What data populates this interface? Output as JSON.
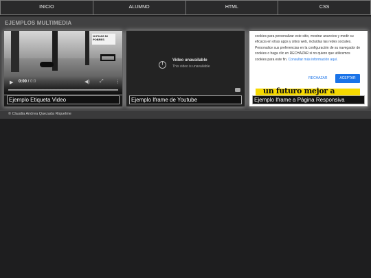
{
  "nav": {
    "items": [
      "INICIO",
      "ALUMNO",
      "HTML",
      "CSS"
    ]
  },
  "section": {
    "title": "EJEMPLOS MULTIMEDIA"
  },
  "cards": {
    "video": {
      "caption": "Ejemplo Etiqueta Video",
      "current_time": "0:00",
      "duration": "0:0",
      "sign_text": "NI PIJAS NI POBRES"
    },
    "youtube": {
      "caption": "Ejemplo Iframe de Youtube",
      "unavailable_title": "Video unavailable",
      "unavailable_sub": "This video is unavailable",
      "icon": "alert-circle-icon"
    },
    "iframe": {
      "caption": "Ejemplo Iframe a Página Responsiva",
      "cookie_text": "cookies para personalizar este sitio, mostrar anuncios y medir su eficacia en otras apps y sitios web, incluidas las redes sociales. Personalice sus preferencias en la configuración de su navegador de cookies o haga clic en RECHAZAR si no quiere que utilicemos cookies para este fin. ",
      "cookie_link": "Consultar más información aquí.",
      "reject_label": "RECHAZAR",
      "accept_label": "ACEPTAR",
      "banner_text": "un futuro mejor a",
      "accent_color": "#1a73e8",
      "banner_color": "#f5d800"
    }
  },
  "footer": {
    "text": "© Claudia Andrea Quezada Riquelme"
  }
}
